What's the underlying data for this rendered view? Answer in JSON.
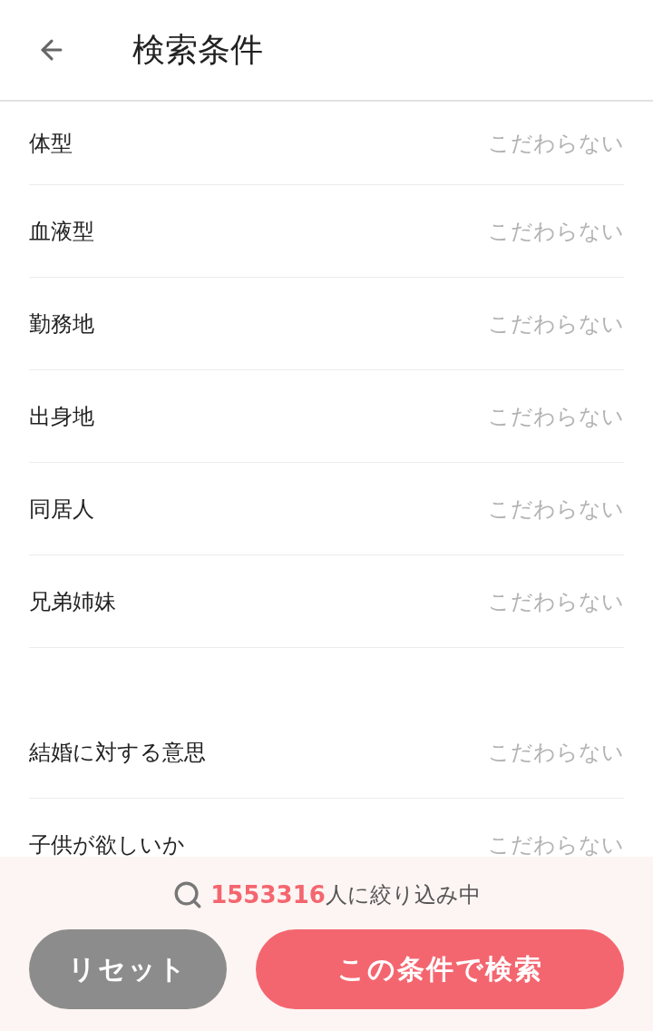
{
  "header": {
    "title": "検索条件"
  },
  "sections": [
    {
      "rows": [
        {
          "label": "体型",
          "value": "こだわらない"
        },
        {
          "label": "血液型",
          "value": "こだわらない"
        },
        {
          "label": "勤務地",
          "value": "こだわらない"
        },
        {
          "label": "出身地",
          "value": "こだわらない"
        },
        {
          "label": "同居人",
          "value": "こだわらない"
        },
        {
          "label": "兄弟姉妹",
          "value": "こだわらない"
        }
      ]
    },
    {
      "rows": [
        {
          "label": "結婚に対する意思",
          "value": "こだわらない"
        },
        {
          "label": "子供が欲しいか",
          "value": "こだわらない"
        }
      ]
    }
  ],
  "footer": {
    "count": "1553316",
    "count_suffix": "人に絞り込み中",
    "buttons": [
      {
        "label": "リセット",
        "kind": "secondary"
      },
      {
        "label": "この条件で検索",
        "kind": "primary"
      }
    ]
  }
}
